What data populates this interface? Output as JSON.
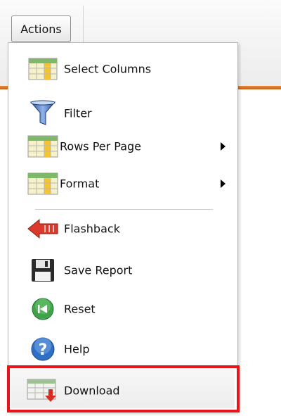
{
  "toolbar": {
    "actions_label": "Actions"
  },
  "menu": {
    "items": [
      {
        "label": "Select Columns",
        "icon": "table-columns-icon"
      },
      {
        "label": "Filter",
        "icon": "funnel-icon"
      },
      {
        "label": "Rows Per Page",
        "icon": "table-rows-icon",
        "submenu": true
      },
      {
        "label": "Format",
        "icon": "table-format-icon",
        "submenu": true
      },
      {
        "label": "Flashback",
        "icon": "back-arrow-icon"
      },
      {
        "label": "Save Report",
        "icon": "floppy-disk-icon"
      },
      {
        "label": "Reset",
        "icon": "rewind-icon"
      },
      {
        "label": "Help",
        "icon": "help-icon"
      },
      {
        "label": "Download",
        "icon": "download-table-icon"
      }
    ]
  },
  "colors": {
    "highlight": "#e8141a",
    "toolbar_accent": "#d06a1e",
    "help_blue": "#2f6fc4",
    "reset_green": "#3fa34a",
    "flashback_red": "#d93a2b"
  }
}
